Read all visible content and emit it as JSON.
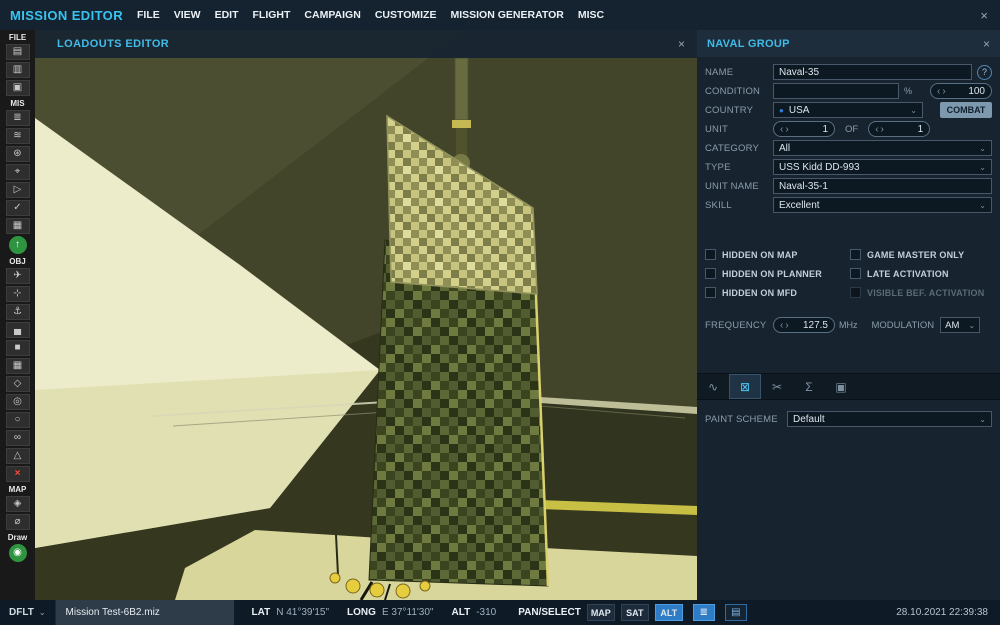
{
  "ui": {
    "chevron_down": "⌄",
    "spinner_left": "‹",
    "spinner_right": "›",
    "country_dot": "●"
  },
  "app": {
    "title": "MISSION EDITOR",
    "menu": [
      "FILE",
      "VIEW",
      "EDIT",
      "FLIGHT",
      "CAMPAIGN",
      "CUSTOMIZE",
      "MISSION GENERATOR",
      "MISC"
    ],
    "close": "×"
  },
  "viewport": {
    "header_title": "LOADOUTS EDITOR",
    "close": "×"
  },
  "toolbar": {
    "sections": [
      {
        "label": "FILE",
        "icons": [
          {
            "name": "new-mission",
            "glyph": "▤"
          },
          {
            "name": "open-mission",
            "glyph": "▥"
          },
          {
            "name": "save-mission",
            "glyph": "▣"
          }
        ]
      },
      {
        "label": "MIS",
        "icons": [
          {
            "name": "briefing",
            "glyph": "≣"
          },
          {
            "name": "weather",
            "glyph": "≋"
          },
          {
            "name": "options",
            "glyph": "⊛"
          },
          {
            "name": "triggers",
            "glyph": "⌖"
          },
          {
            "name": "goals",
            "glyph": "▷"
          },
          {
            "name": "mission-check",
            "glyph": "✓"
          },
          {
            "name": "generator",
            "glyph": "▦"
          },
          {
            "name": "fly-mission",
            "glyph": "↑"
          }
        ]
      },
      {
        "label": "OBJ",
        "icons": [
          {
            "name": "add-aircraft",
            "glyph": "✈"
          },
          {
            "name": "add-helicopter",
            "glyph": "⊹"
          },
          {
            "name": "add-ship",
            "glyph": "⚓"
          },
          {
            "name": "add-vehicle",
            "glyph": "▄"
          },
          {
            "name": "add-static-object",
            "glyph": "■"
          },
          {
            "name": "add-template",
            "glyph": "▦"
          },
          {
            "name": "add-initial-point",
            "glyph": "◇"
          },
          {
            "name": "add-trigger-zone",
            "glyph": "◎"
          },
          {
            "name": "add-circle-zone",
            "glyph": "○"
          },
          {
            "name": "add-sequence",
            "glyph": "∞"
          },
          {
            "name": "add-shape",
            "glyph": "△"
          },
          {
            "name": "delete-object",
            "glyph": "×"
          }
        ]
      },
      {
        "label": "MAP",
        "icons": [
          {
            "name": "map-layers",
            "glyph": "◈"
          },
          {
            "name": "measure-distance",
            "glyph": "⌀"
          }
        ]
      },
      {
        "label": "Draw",
        "icons": [
          {
            "name": "about",
            "glyph": "◉"
          }
        ]
      }
    ]
  },
  "naval_group": {
    "title": "NAVAL GROUP",
    "close": "×",
    "name_label": "NAME",
    "name_value": "Naval-35",
    "help": "?",
    "condition_label": "CONDITION",
    "condition_value": "",
    "percent": "%",
    "condition_spin": "100",
    "country_label": "COUNTRY",
    "country_value": "USA",
    "combat_button": "COMBAT",
    "unit_label": "UNIT",
    "unit_count": "1",
    "of_label": "OF",
    "of_count": "1",
    "category_label": "CATEGORY",
    "category_value": "All",
    "type_label": "TYPE",
    "type_value": "USS Kidd DD-993",
    "unit_name_label": "UNIT NAME",
    "unit_name_value": "Naval-35-1",
    "skill_label": "SKILL",
    "skill_value": "Excellent",
    "checkboxes_left": [
      "HIDDEN ON MAP",
      "HIDDEN ON PLANNER",
      "HIDDEN ON MFD"
    ],
    "checkboxes_right": [
      "GAME MASTER ONLY",
      "LATE ACTIVATION",
      "VISIBLE BEF. ACTIVATION"
    ],
    "frequency_label": "FREQUENCY",
    "frequency_value": "127.5",
    "frequency_unit": "MHz",
    "modulation_label": "MODULATION",
    "modulation_value": "AM",
    "tabs": [
      {
        "name": "route",
        "glyph": "∿"
      },
      {
        "name": "attack",
        "glyph": "⊠"
      },
      {
        "name": "payload",
        "glyph": "✂"
      },
      {
        "name": "summary",
        "glyph": "Σ"
      },
      {
        "name": "cargo",
        "glyph": "▣"
      }
    ],
    "paint_scheme_label": "PAINT SCHEME",
    "paint_scheme_value": "Default"
  },
  "status_bar": {
    "dflt_label": "DFLT",
    "mission_file": "Mission Test-6B2.miz",
    "lat_label": "LAT",
    "lat_value": "N 41°39'15\"",
    "long_label": "LONG",
    "long_value": "E 37°11'30\"",
    "alt_label": "ALT",
    "alt_value": "-310",
    "mode_label": "PAN/SELECT",
    "map_button": "MAP",
    "sat_button": "SAT",
    "alt_button": "ALT",
    "scale_icon": "≣",
    "window_icon": "▤",
    "datetime": "28.10.2021 22:39:38"
  }
}
